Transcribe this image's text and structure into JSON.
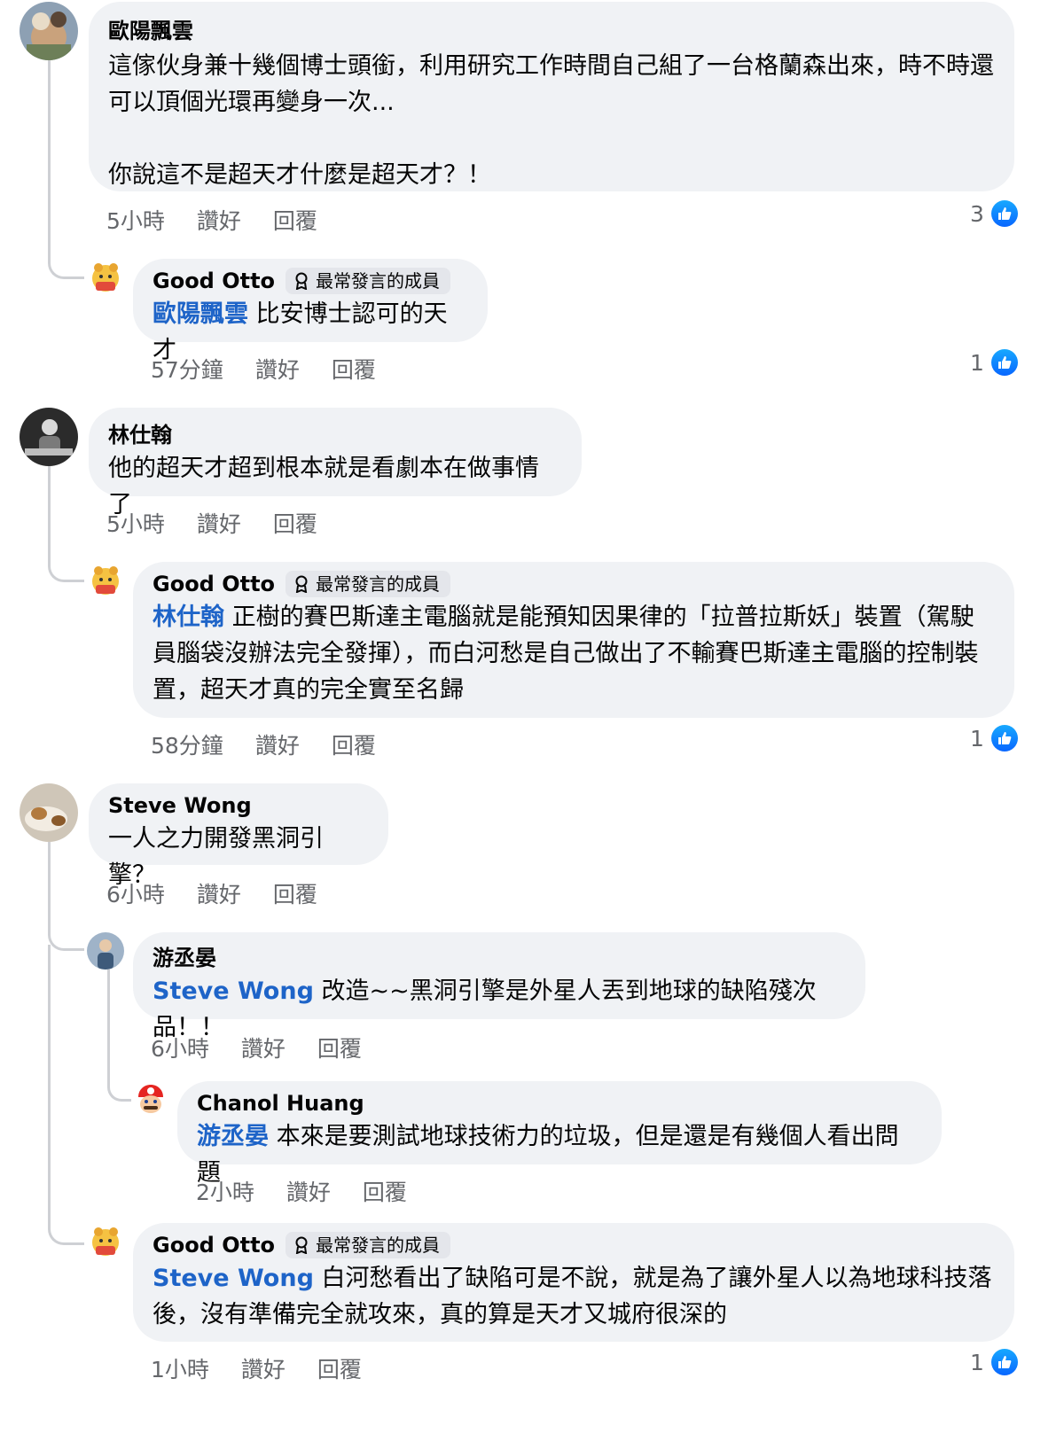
{
  "comments": [
    {
      "author": "歐陽飄雲",
      "text": "這傢伙身兼十幾個博士頭銜，利用研究工作時間自己組了一台格蘭森出來，時不時還可以頂個光環再變身一次...\n\n你說這不是超天才什麼是超天才？！",
      "time": "5小時",
      "like_label": "讚好",
      "reply_label": "回覆",
      "likes": "3",
      "replies": [
        {
          "author": "Good Otto",
          "badge": "最常發言的成員",
          "mention": "歐陽飄雲",
          "text": " 比安博士認可的天才",
          "time": "57分鐘",
          "like_label": "讚好",
          "reply_label": "回覆",
          "likes": "1"
        }
      ]
    },
    {
      "author": "林仕翰",
      "text": "他的超天才超到根本就是看劇本在做事情了",
      "time": "5小時",
      "like_label": "讚好",
      "reply_label": "回覆",
      "replies": [
        {
          "author": "Good Otto",
          "badge": "最常發言的成員",
          "mention": "林仕翰",
          "text": " 正樹的賽巴斯達主電腦就是能預知因果律的「拉普拉斯妖」裝置（駕駛員腦袋沒辦法完全發揮），而白河愁是自己做出了不輸賽巴斯達主電腦的控制裝置，超天才真的完全實至名歸",
          "time": "58分鐘",
          "like_label": "讚好",
          "reply_label": "回覆",
          "likes": "1"
        }
      ]
    },
    {
      "author": "Steve Wong",
      "text": "一人之力開發黑洞引擎？",
      "time": "6小時",
      "like_label": "讚好",
      "reply_label": "回覆",
      "replies": [
        {
          "author": "游丞晏",
          "mention": "Steve Wong",
          "text": " 改造~~黑洞引擎是外星人丟到地球的缺陷殘次品！！",
          "time": "6小時",
          "like_label": "讚好",
          "reply_label": "回覆"
        },
        {
          "author": "Chanol Huang",
          "mention": "游丞晏",
          "text": " 本來是要測試地球技術力的垃圾，但是還是有幾個人看出問題",
          "time": "2小時",
          "like_label": "讚好",
          "reply_label": "回覆"
        },
        {
          "author": "Good Otto",
          "badge": "最常發言的成員",
          "mention": "Steve Wong",
          "text": " 白河愁看出了缺陷可是不說，就是為了讓外星人以為地球科技落後，沒有準備完全就攻來，真的算是天才又城府很深的",
          "time": "1小時",
          "like_label": "讚好",
          "reply_label": "回覆",
          "likes": "1"
        }
      ]
    }
  ]
}
